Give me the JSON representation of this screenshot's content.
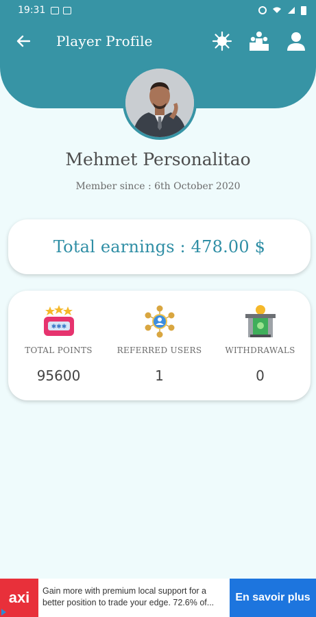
{
  "status_bar": {
    "time": "19:31"
  },
  "toolbar": {
    "title": "Player Profile"
  },
  "profile": {
    "name": "Mehmet Personalitao",
    "member_since": "Member since : 6th October 2020"
  },
  "earnings": {
    "text": "Total earnings : 478.00 $"
  },
  "stats": [
    {
      "label": "TOTAL POINTS",
      "value": "95600",
      "icon": "points-icon"
    },
    {
      "label": "REFERRED USERS",
      "value": "1",
      "icon": "referral-network-icon"
    },
    {
      "label": "WITHDRAWALS",
      "value": "0",
      "icon": "withdrawal-icon"
    }
  ],
  "ad": {
    "logo": "axi",
    "text": "Gain more with premium local support for a better position to trade your edge. 72.6% of...",
    "cta": "En savoir plus"
  },
  "colors": {
    "header": "#3794a5",
    "accent": "#2f8ea5",
    "background": "#effbfc",
    "ad_cta": "#1d75de",
    "ad_logo": "#e8303a"
  }
}
